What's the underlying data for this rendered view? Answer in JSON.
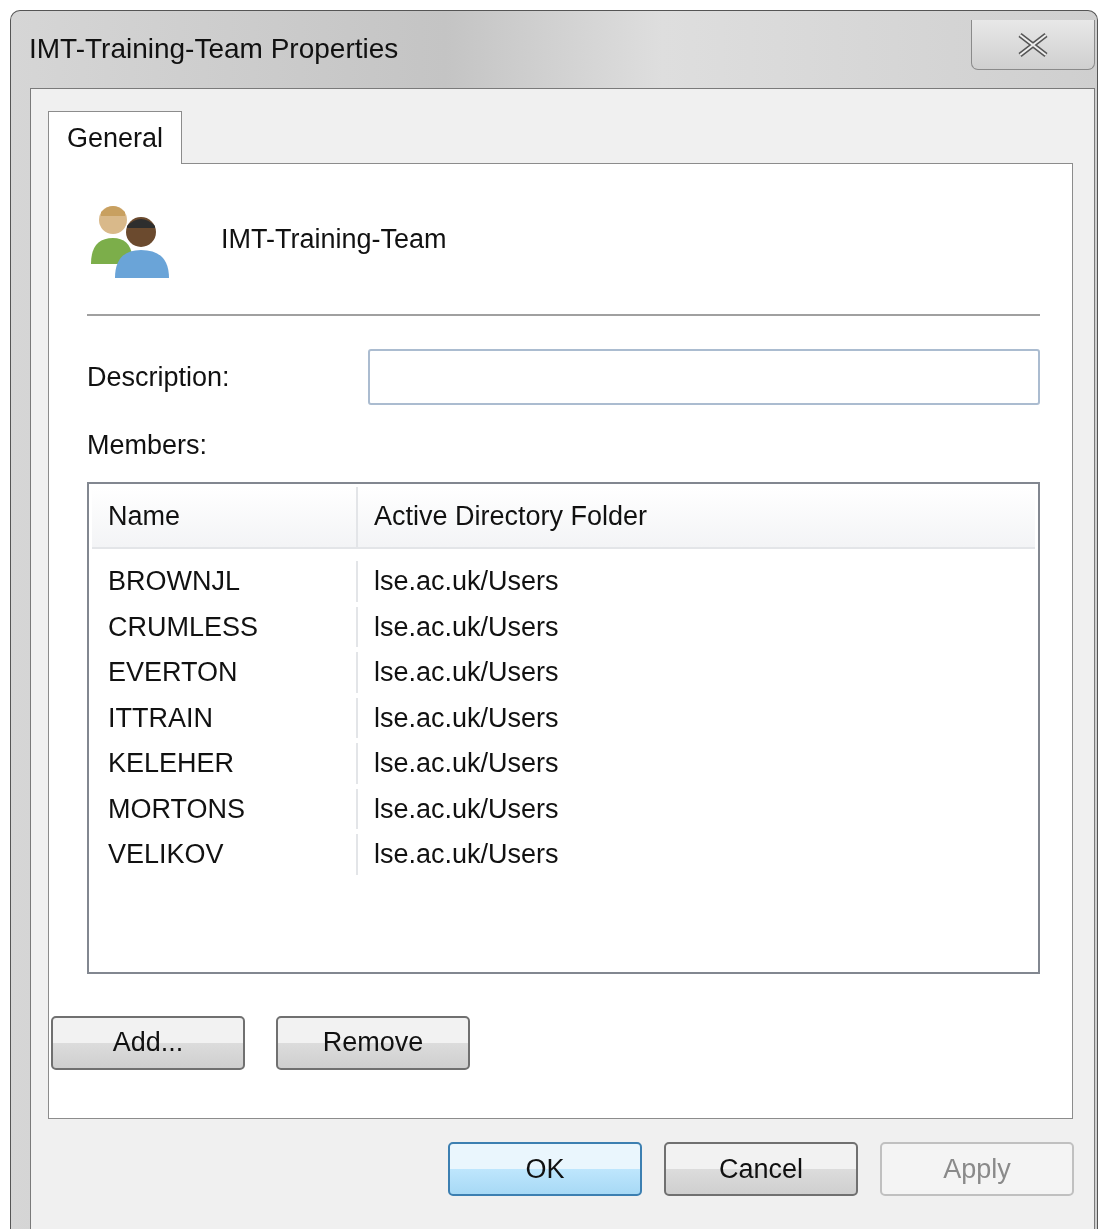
{
  "window": {
    "title": "IMT-Training-Team Properties"
  },
  "tabs": [
    {
      "label": "General",
      "selected": true
    }
  ],
  "group": {
    "name": "IMT-Training-Team"
  },
  "description": {
    "label": "Description:"
  },
  "members": {
    "label": "Members:",
    "columns": [
      "Name",
      "Active Directory Folder"
    ],
    "rows": [
      {
        "name": "BROWNJL",
        "folder": "lse.ac.uk/Users"
      },
      {
        "name": "CRUMLESS",
        "folder": "lse.ac.uk/Users"
      },
      {
        "name": "EVERTON",
        "folder": "lse.ac.uk/Users"
      },
      {
        "name": "ITTRAIN",
        "folder": "lse.ac.uk/Users"
      },
      {
        "name": "KELEHER",
        "folder": "lse.ac.uk/Users"
      },
      {
        "name": "MORTONS",
        "folder": "lse.ac.uk/Users"
      },
      {
        "name": "VELIKOV",
        "folder": "lse.ac.uk/Users"
      }
    ]
  },
  "member_buttons": [
    {
      "label": "Add...",
      "disabled": false
    },
    {
      "label": "Remove",
      "disabled": false
    }
  ],
  "dialog_buttons": [
    {
      "label": "OK",
      "default": true,
      "disabled": false
    },
    {
      "label": "Cancel",
      "default": false,
      "disabled": false
    },
    {
      "label": "Apply",
      "default": false,
      "disabled": true
    }
  ]
}
